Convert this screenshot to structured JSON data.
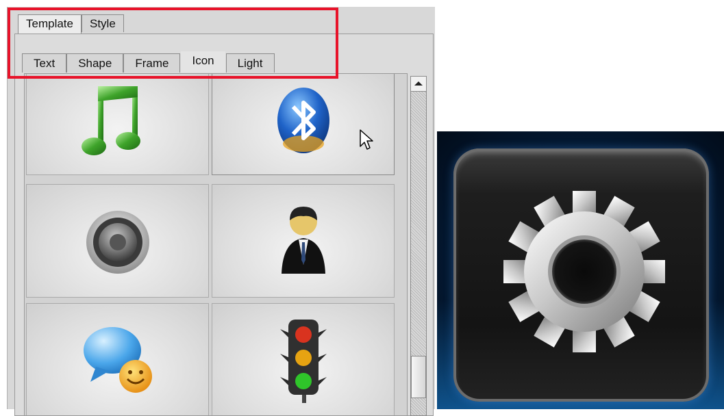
{
  "outer_tabs": [
    {
      "label": "Template",
      "active": true
    },
    {
      "label": "Style",
      "active": false
    }
  ],
  "inner_tabs": [
    {
      "label": "Text",
      "active": false
    },
    {
      "label": "Shape",
      "active": false
    },
    {
      "label": "Frame",
      "active": false
    },
    {
      "label": "Icon",
      "active": true
    },
    {
      "label": "Light",
      "active": false
    }
  ],
  "icon_grid": [
    {
      "icon": "music-note-icon"
    },
    {
      "icon": "bluetooth-icon"
    },
    {
      "icon": "speaker-icon"
    },
    {
      "icon": "user-icon"
    },
    {
      "icon": "chat-icon"
    },
    {
      "icon": "traffic-light-icon"
    }
  ],
  "preview": {
    "icon": "gear-icon"
  },
  "colors": {
    "highlight": "#e8132a",
    "tile": "#1c1c1c",
    "glow": "#1678c8"
  }
}
